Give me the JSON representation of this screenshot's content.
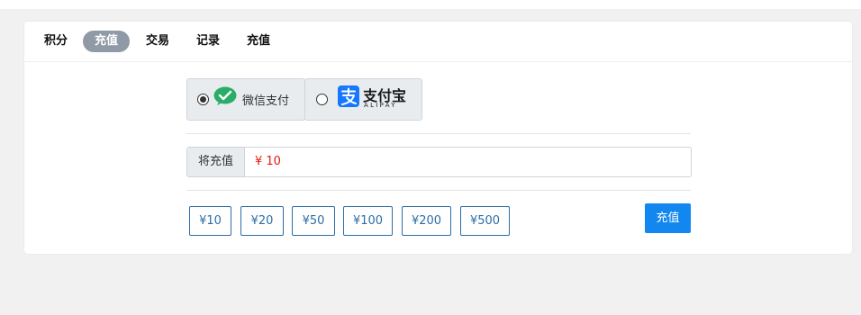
{
  "tabs": [
    {
      "label": "积分",
      "active": false
    },
    {
      "label": "充值",
      "active": true
    },
    {
      "label": "交易",
      "active": false
    },
    {
      "label": "记录",
      "active": false
    },
    {
      "label": "充值",
      "active": false
    }
  ],
  "payment": {
    "wechat": {
      "label": "微信支付",
      "selected": true,
      "icon": "wechat-icon"
    },
    "alipay": {
      "title": "支付宝",
      "subtitle": "ALIPAY",
      "selected": false,
      "icon": "alipay-icon"
    }
  },
  "amount": {
    "prefix_label": "将充值",
    "value": "¥ 10"
  },
  "quick_amounts": [
    "¥10",
    "¥20",
    "¥50",
    "¥100",
    "¥200",
    "¥500"
  ],
  "submit_label": "充值",
  "colors": {
    "accent": "#1387f0",
    "quick_border": "#2c6ea6",
    "amount_text": "#e4190e",
    "active_tab_bg": "#8f9aa6",
    "wechat_green": "#2aae67",
    "alipay_blue": "#1677ff"
  }
}
